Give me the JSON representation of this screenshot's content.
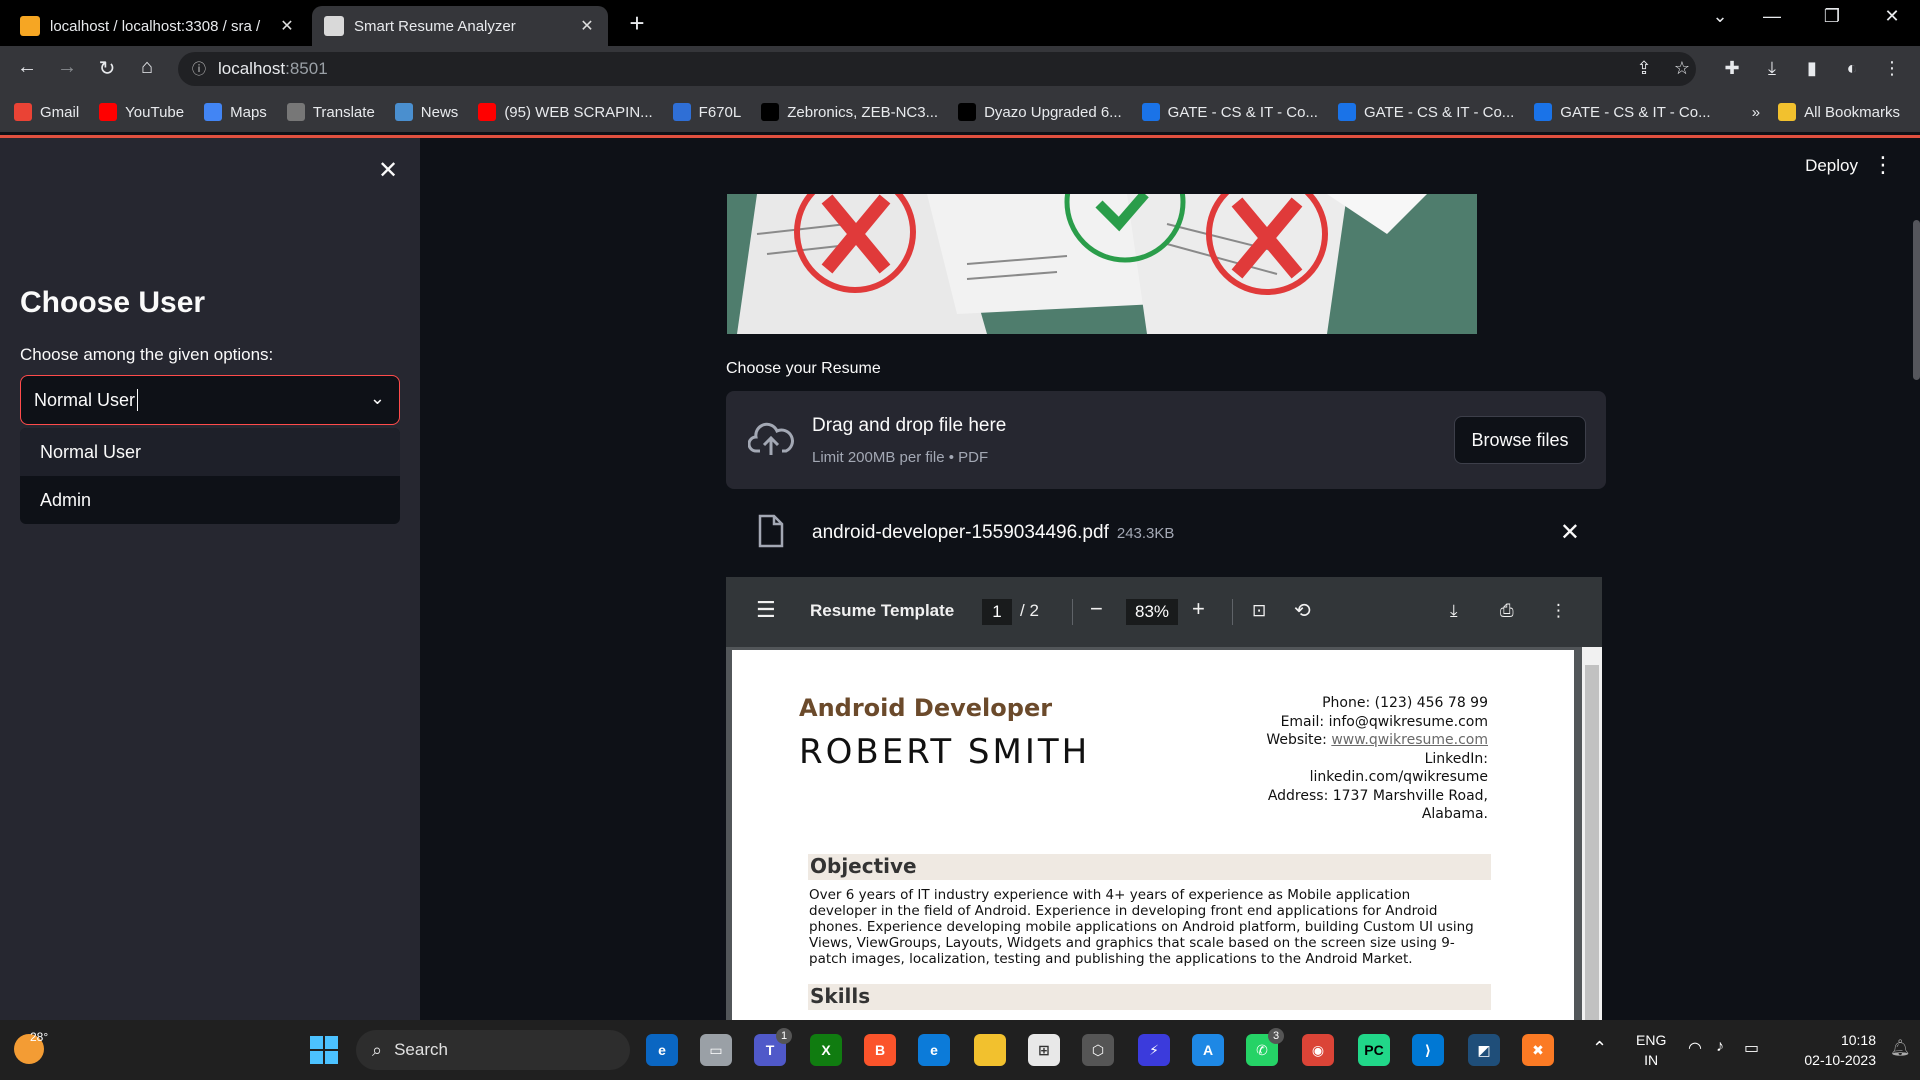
{
  "browser": {
    "tabs": [
      {
        "title": "localhost / localhost:3308 / sra /",
        "active": false
      },
      {
        "title": "Smart Resume Analyzer",
        "active": true
      }
    ],
    "address": {
      "host": "localhost",
      "port": ":8501"
    },
    "bookmarks": [
      {
        "label": "Gmail",
        "icon": "gmail-icon",
        "color": "#ea4335"
      },
      {
        "label": "YouTube",
        "icon": "youtube-icon",
        "color": "#ff0000"
      },
      {
        "label": "Maps",
        "icon": "google-icon",
        "color": "#4285f4"
      },
      {
        "label": "Translate",
        "icon": "translate-icon",
        "color": "#777777"
      },
      {
        "label": "News",
        "icon": "news-icon",
        "color": "#4a8fcf"
      },
      {
        "label": "(95) WEB SCRAPIN...",
        "icon": "youtube-icon",
        "color": "#ff0000"
      },
      {
        "label": "F670L",
        "icon": "zte-icon",
        "color": "#2f6fd6"
      },
      {
        "label": "Zebronics, ZEB-NC3...",
        "icon": "v-icon",
        "color": "#000000"
      },
      {
        "label": "Dyazo Upgraded 6...",
        "icon": "v-icon",
        "color": "#000000"
      },
      {
        "label": "GATE - CS & IT - Co...",
        "icon": "gate-icon",
        "color": "#1a73e8"
      },
      {
        "label": "GATE - CS & IT - Co...",
        "icon": "gate-icon",
        "color": "#1a73e8"
      },
      {
        "label": "GATE - CS & IT - Co...",
        "icon": "gate-icon",
        "color": "#1a73e8"
      }
    ],
    "all_bookmarks": "All Bookmarks"
  },
  "sidebar": {
    "title": "Choose User",
    "select_label": "Choose among the given options:",
    "selected": "Normal User",
    "options": [
      "Normal User",
      "Admin"
    ]
  },
  "header": {
    "deploy": "Deploy"
  },
  "main": {
    "uploader_label": "Choose your Resume",
    "drag_text": "Drag and drop file here",
    "limit_text": "Limit 200MB per file • PDF",
    "browse": "Browse files",
    "file_name": "android-developer-1559034496.pdf",
    "file_size": "243.3KB"
  },
  "pdf": {
    "title": "Resume Template",
    "page": "1",
    "pages": "/  2",
    "zoom": "83%",
    "resume": {
      "role": "Android Developer",
      "name": "ROBERT SMITH",
      "phone": "Phone: (123) 456 78 99",
      "email": "Email: info@qwikresume.com",
      "website_label": "Website: ",
      "website": "www.qwikresume.com",
      "linkedin_label": "LinkedIn:",
      "linkedin": "linkedin.com/qwikresume",
      "address1": "Address: 1737 Marshville Road,",
      "address2": "Alabama.",
      "section_objective": "Objective",
      "objective_lines": [
        "Over 6 years of IT industry experience with 4+ years of experience as Mobile application",
        "developer in the field of Android. Experience in developing front end applications for Android",
        "phones. Experience developing mobile applications on Android platform, building Custom UI using",
        "Views, ViewGroups, Layouts, Widgets and graphics that scale based on the screen size using 9-",
        "patch images, localization, testing and publishing the applications to the Android Market."
      ],
      "section_skills": "Skills"
    }
  },
  "taskbar": {
    "weather_temp": "28°",
    "search": "Search",
    "lang1": "ENG",
    "lang2": "IN",
    "time": "10:18",
    "date": "02-10-2023",
    "teams_badge": "1",
    "whatsapp_badge": "3"
  },
  "colors": {
    "accent": "#ff4b4b",
    "sidebar_bg": "#262730",
    "app_bg": "#0e1117"
  }
}
